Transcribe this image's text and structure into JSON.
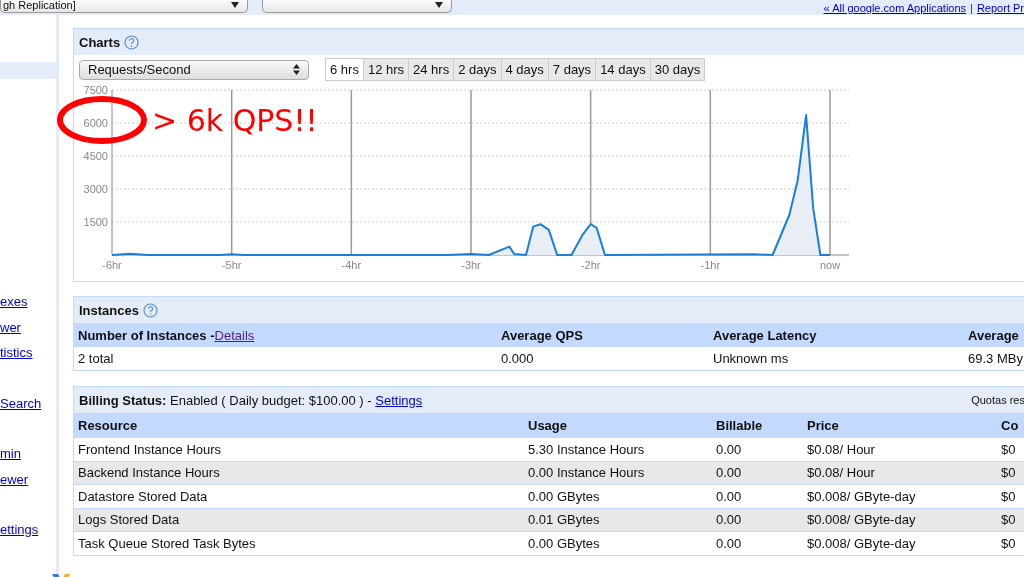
{
  "top_bar": {
    "app_dropdown": {
      "value": "gh Replication]"
    },
    "links": [
      "« All google.com Applications",
      "Report Pr"
    ],
    "separator": "|"
  },
  "sidebar": {
    "groups": [
      {
        "links": [
          "exes",
          "wer",
          "tistics"
        ]
      },
      {
        "links": [
          "Search"
        ]
      },
      {
        "links": [
          "min",
          "ewer"
        ]
      },
      {
        "links": [
          "ettings"
        ]
      }
    ]
  },
  "charts": {
    "title": "Charts",
    "metric": "Requests/Second",
    "ranges": [
      {
        "label": "6 hrs",
        "selected": true
      },
      {
        "label": "12 hrs",
        "selected": false
      },
      {
        "label": "24 hrs",
        "selected": false
      },
      {
        "label": "2 days",
        "selected": false
      },
      {
        "label": "4 days",
        "selected": false
      },
      {
        "label": "7 days",
        "selected": false
      },
      {
        "label": "14 days",
        "selected": false
      },
      {
        "label": "30 days",
        "selected": false
      }
    ],
    "chart_data": {
      "type": "area",
      "x": [
        -6,
        -5.85,
        -5.7,
        -5.1,
        -5.0,
        -4.9,
        -3.2,
        -3.0,
        -2.85,
        -2.68,
        -2.64,
        -2.54,
        -2.48,
        -2.42,
        -2.35,
        -2.28,
        -2.16,
        -2.07,
        -2.0,
        -1.95,
        -1.88,
        -0.64,
        -0.48,
        -0.34,
        -0.27,
        -0.2,
        -0.14,
        -0.08,
        0
      ],
      "series": [
        {
          "color": "#1a7fd6",
          "values": [
            0,
            60,
            0,
            0,
            30,
            0,
            0,
            40,
            0,
            380,
            50,
            0,
            1290,
            1400,
            1140,
            0,
            0,
            900,
            1400,
            1230,
            0,
            30,
            0,
            1820,
            3400,
            6360,
            2120,
            0,
            0
          ]
        }
      ],
      "xlim": [
        -6,
        0
      ],
      "ylim": [
        0,
        7500
      ],
      "xticks": [
        {
          "value": -6,
          "label": "-6hr"
        },
        {
          "value": -5,
          "label": "-5hr"
        },
        {
          "value": -4,
          "label": "-4hr"
        },
        {
          "value": -3,
          "label": "-3hr"
        },
        {
          "value": -2,
          "label": "-2hr"
        },
        {
          "value": -1,
          "label": "-1hr"
        },
        {
          "value": 0,
          "label": "now"
        }
      ],
      "yticks": [
        1500,
        3000,
        4500,
        6000,
        7500
      ],
      "grid": true
    },
    "annotation": "> 6k QPS!!"
  },
  "instances": {
    "title": "Instances",
    "columns": [
      {
        "label": "Number of Instances -",
        "link": "Details"
      },
      {
        "label": "Average QPS"
      },
      {
        "label": "Average Latency"
      },
      {
        "label": "Average"
      }
    ],
    "rows": [
      [
        "2 total",
        "0.000",
        "Unknown ms",
        "69.3 MBy"
      ]
    ]
  },
  "billing": {
    "status": "**Billing Status:** Enabled ( Daily budget: $100.00 ) -",
    "link": "Settings",
    "note": "Quotas res",
    "columns": [
      "Resource",
      "Usage",
      "Billable",
      "Price",
      "Co"
    ],
    "rows": [
      [
        "Frontend Instance Hours",
        "5.30 Instance Hours",
        "0.00",
        "$0.08/ Hour",
        "$0"
      ],
      [
        "Backend Instance Hours",
        "0.00 Instance Hours",
        "0.00",
        "$0.08/ Hour",
        "$0"
      ],
      [
        "Datastore Stored Data",
        "0.00 GBytes",
        "0.00",
        "$0.008/ GByte-day",
        "$0"
      ],
      [
        "Logs Stored Data",
        "0.01 GBytes",
        "0.00",
        "$0.008/ GByte-day",
        "$0"
      ],
      [
        "Task Queue Stored Task Bytes",
        "0.00 GBytes",
        "0.00",
        "$0.008/ GByte-day",
        "$0"
      ]
    ]
  }
}
